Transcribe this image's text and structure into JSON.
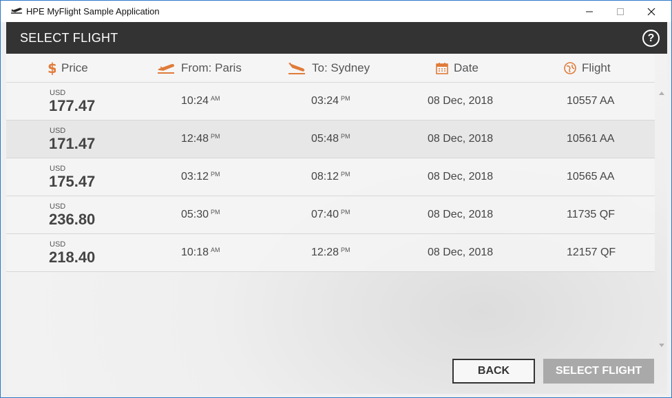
{
  "window": {
    "title": "HPE MyFlight Sample Application"
  },
  "header": {
    "title": "SELECT FLIGHT",
    "help_label": "?"
  },
  "columns": {
    "price": "Price",
    "from": "From: Paris",
    "to": "To: Sydney",
    "date": "Date",
    "flight": "Flight"
  },
  "flights": [
    {
      "currency": "USD",
      "price": "177.47",
      "dep": "10:24",
      "dep_ampm": "AM",
      "arr": "03:24",
      "arr_ampm": "PM",
      "date": "08 Dec, 2018",
      "flight": "10557 AA"
    },
    {
      "currency": "USD",
      "price": "171.47",
      "dep": "12:48",
      "dep_ampm": "PM",
      "arr": "05:48",
      "arr_ampm": "PM",
      "date": "08 Dec, 2018",
      "flight": "10561 AA"
    },
    {
      "currency": "USD",
      "price": "175.47",
      "dep": "03:12",
      "dep_ampm": "PM",
      "arr": "08:12",
      "arr_ampm": "PM",
      "date": "08 Dec, 2018",
      "flight": "10565 AA"
    },
    {
      "currency": "USD",
      "price": "236.80",
      "dep": "05:30",
      "dep_ampm": "PM",
      "arr": "07:40",
      "arr_ampm": "PM",
      "date": "08 Dec, 2018",
      "flight": "11735 QF"
    },
    {
      "currency": "USD",
      "price": "218.40",
      "dep": "10:18",
      "dep_ampm": "AM",
      "arr": "12:28",
      "arr_ampm": "PM",
      "date": "08 Dec, 2018",
      "flight": "12157 QF"
    }
  ],
  "buttons": {
    "back": "BACK",
    "select": "SELECT FLIGHT"
  },
  "colors": {
    "accent": "#e07b39",
    "header_bg": "#333333",
    "select_disabled": "#a9a9a9"
  },
  "icons": {
    "price": "dollar-icon",
    "from": "takeoff-icon",
    "to": "landing-icon",
    "date": "calendar-icon",
    "flight": "globe-icon"
  }
}
